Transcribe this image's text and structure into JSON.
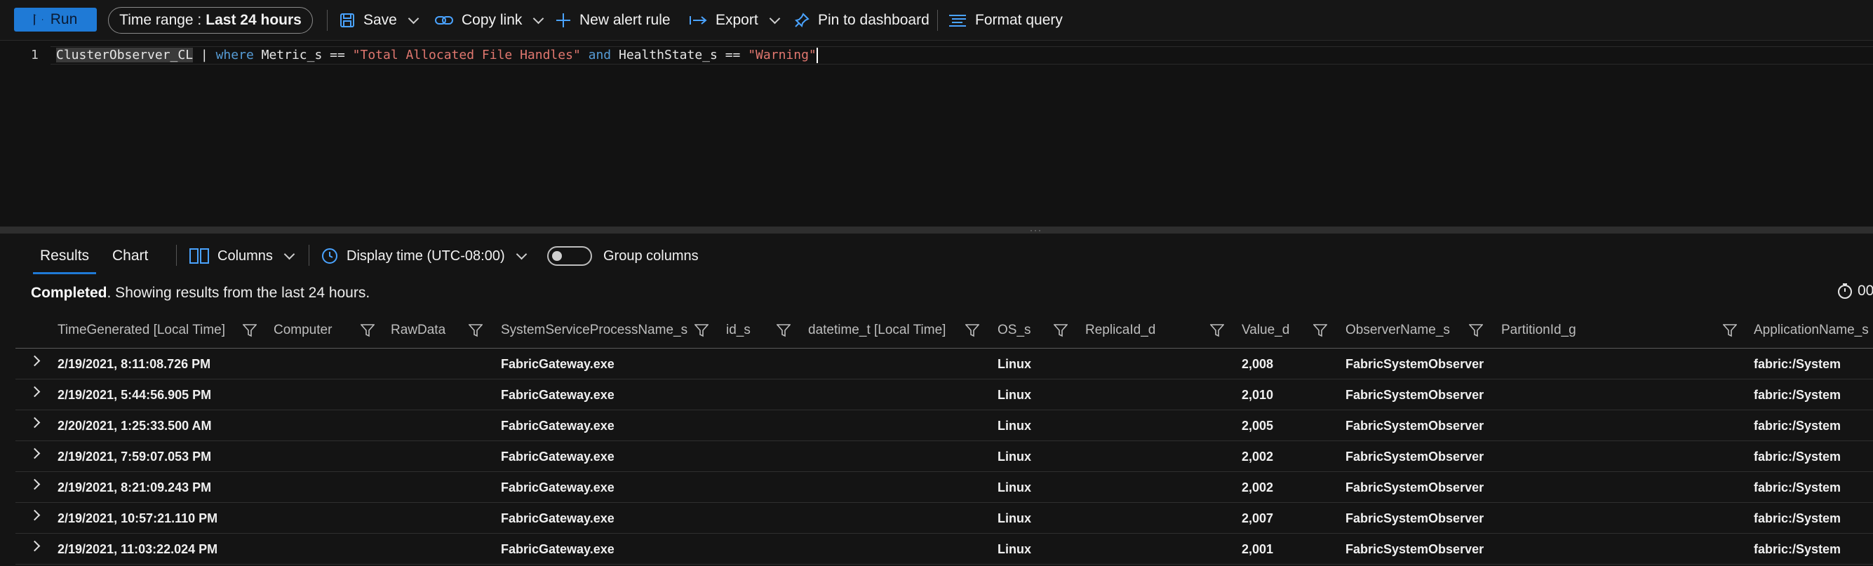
{
  "toolbar": {
    "run_label": "Run",
    "time_range_label": "Time range :",
    "time_range_value": "Last 24 hours",
    "save_label": "Save",
    "copy_link_label": "Copy link",
    "new_alert_label": "New alert rule",
    "export_label": "Export",
    "pin_label": "Pin to dashboard",
    "format_label": "Format query"
  },
  "editor": {
    "line_number": "1",
    "tokens": {
      "table": "ClusterObserver_CL",
      "pipe": " | ",
      "where": "where",
      "field1": " Metric_s == ",
      "str1": "\"Total Allocated File Handles\"",
      "and": " and",
      "field2": " HealthState_s == ",
      "str2": "\"Warning\""
    }
  },
  "results": {
    "tabs": [
      "Results",
      "Chart"
    ],
    "columns_label": "Columns",
    "display_time_label": "Display time (UTC-08:00)",
    "group_columns_label": "Group columns",
    "status_bold": "Completed",
    "status_rest": ". Showing results from the last 24 hours.",
    "timer_text": "00"
  },
  "grid": {
    "headers": [
      "TimeGenerated [Local Time]",
      "Computer",
      "RawData",
      "SystemServiceProcessName_s",
      "id_s",
      "datetime_t [Local Time]",
      "OS_s",
      "ReplicaId_d",
      "Value_d",
      "ObserverName_s",
      "PartitionId_g",
      "ApplicationName_s"
    ],
    "rows": [
      [
        "2/19/2021, 8:11:08.726 PM",
        "FabricGateway.exe",
        "Linux",
        "2,008",
        "FabricSystemObserver",
        "fabric:/System"
      ],
      [
        "2/19/2021, 5:44:56.905 PM",
        "FabricGateway.exe",
        "Linux",
        "2,010",
        "FabricSystemObserver",
        "fabric:/System"
      ],
      [
        "2/20/2021, 1:25:33.500 AM",
        "FabricGateway.exe",
        "Linux",
        "2,005",
        "FabricSystemObserver",
        "fabric:/System"
      ],
      [
        "2/19/2021, 7:59:07.053 PM",
        "FabricGateway.exe",
        "Linux",
        "2,002",
        "FabricSystemObserver",
        "fabric:/System"
      ],
      [
        "2/19/2021, 8:21:09.243 PM",
        "FabricGateway.exe",
        "Linux",
        "2,002",
        "FabricSystemObserver",
        "fabric:/System"
      ],
      [
        "2/19/2021, 10:57:21.110 PM",
        "FabricGateway.exe",
        "Linux",
        "2,007",
        "FabricSystemObserver",
        "fabric:/System"
      ],
      [
        "2/19/2021, 11:03:22.024 PM",
        "FabricGateway.exe",
        "Linux",
        "2,001",
        "FabricSystemObserver",
        "fabric:/System"
      ]
    ]
  },
  "colors": {
    "accent": "#1f7ad6",
    "keyword": "#569cd6",
    "string": "#e0776f"
  }
}
